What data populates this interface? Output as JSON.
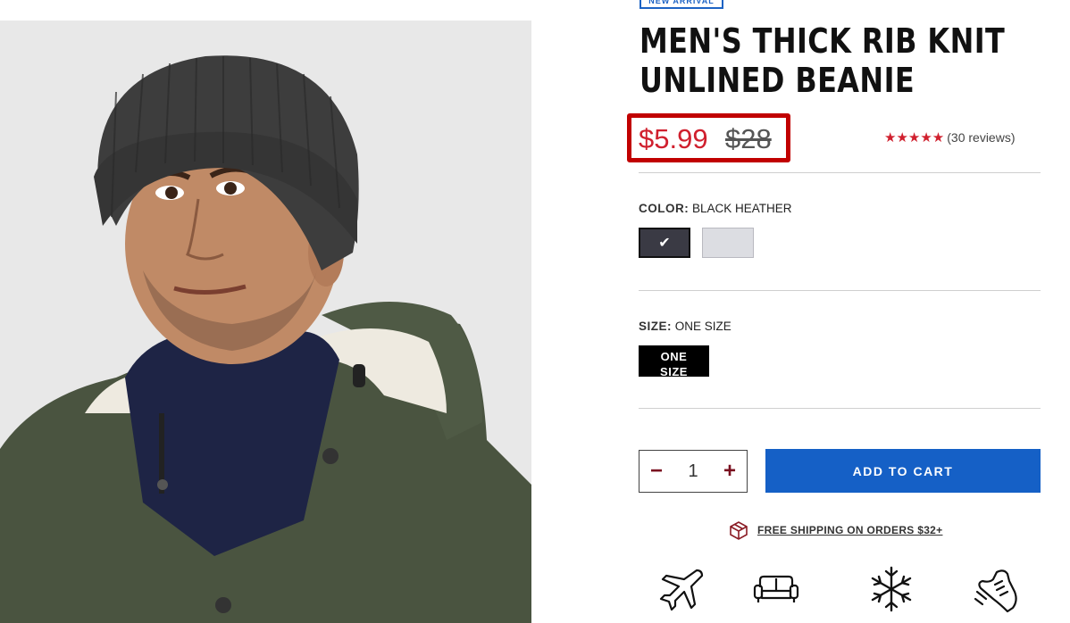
{
  "product": {
    "badge": "NEW ARRIVAL",
    "title_line1": "MEN'S THICK RIB KNIT",
    "title_line2": "UNLINED BEANIE",
    "sale_price": "$5.99",
    "original_price": "$28",
    "rating_stars": "★★★★★",
    "reviews": "(30 reviews)",
    "rating": 5
  },
  "color": {
    "label": "COLOR:",
    "selected": "BLACK HEATHER",
    "swatches": [
      {
        "name": "Black Heather",
        "hex": "#3a3a44",
        "selected": true
      },
      {
        "name": "Light Gray",
        "hex": "#dcdde2",
        "selected": false
      }
    ],
    "check": "✔"
  },
  "size": {
    "label": "SIZE:",
    "selected": "ONE SIZE",
    "button_line1": "ONE",
    "button_line2": "SIZE"
  },
  "quantity": {
    "minus": "−",
    "value": "1",
    "plus": "+"
  },
  "cart": {
    "add_label": "ADD TO CART"
  },
  "shipping": {
    "text": "FREE SHIPPING ON ORDERS $32+"
  },
  "features": [
    "airplane-icon",
    "couch-icon",
    "snowflake-icon",
    "shoe-icon"
  ],
  "colors": {
    "sale_red": "#d0202e",
    "highlight_red": "#c10000",
    "primary_blue": "#1560c6",
    "qty_accent": "#7a1020"
  }
}
